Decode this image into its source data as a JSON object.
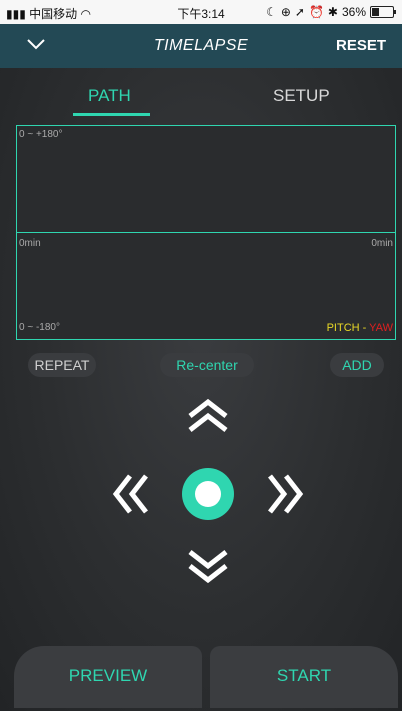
{
  "status_bar": {
    "carrier": "中国移动",
    "time": "下午3:14",
    "battery": "36%"
  },
  "nav": {
    "title": "TIMELAPSE",
    "reset_label": "RESET"
  },
  "tabs": [
    {
      "label": "PATH",
      "active": true
    },
    {
      "label": "SETUP",
      "active": false
    }
  ],
  "graph": {
    "top_range": "0 ~ +180°",
    "bottom_range": "0 ~ -180°",
    "left_time": "0min",
    "right_time": "0min",
    "legend_pitch": "PITCH",
    "legend_sep": " - ",
    "legend_yaw": "YAW",
    "pitch_color": "#e8d826",
    "yaw_color": "#e02020"
  },
  "controls": {
    "repeat_label": "REPEAT",
    "recenter_label": "Re-center",
    "add_label": "ADD",
    "accent_color": "#2fd6b0"
  },
  "bottom": {
    "preview_label": "PREVIEW",
    "start_label": "START"
  }
}
